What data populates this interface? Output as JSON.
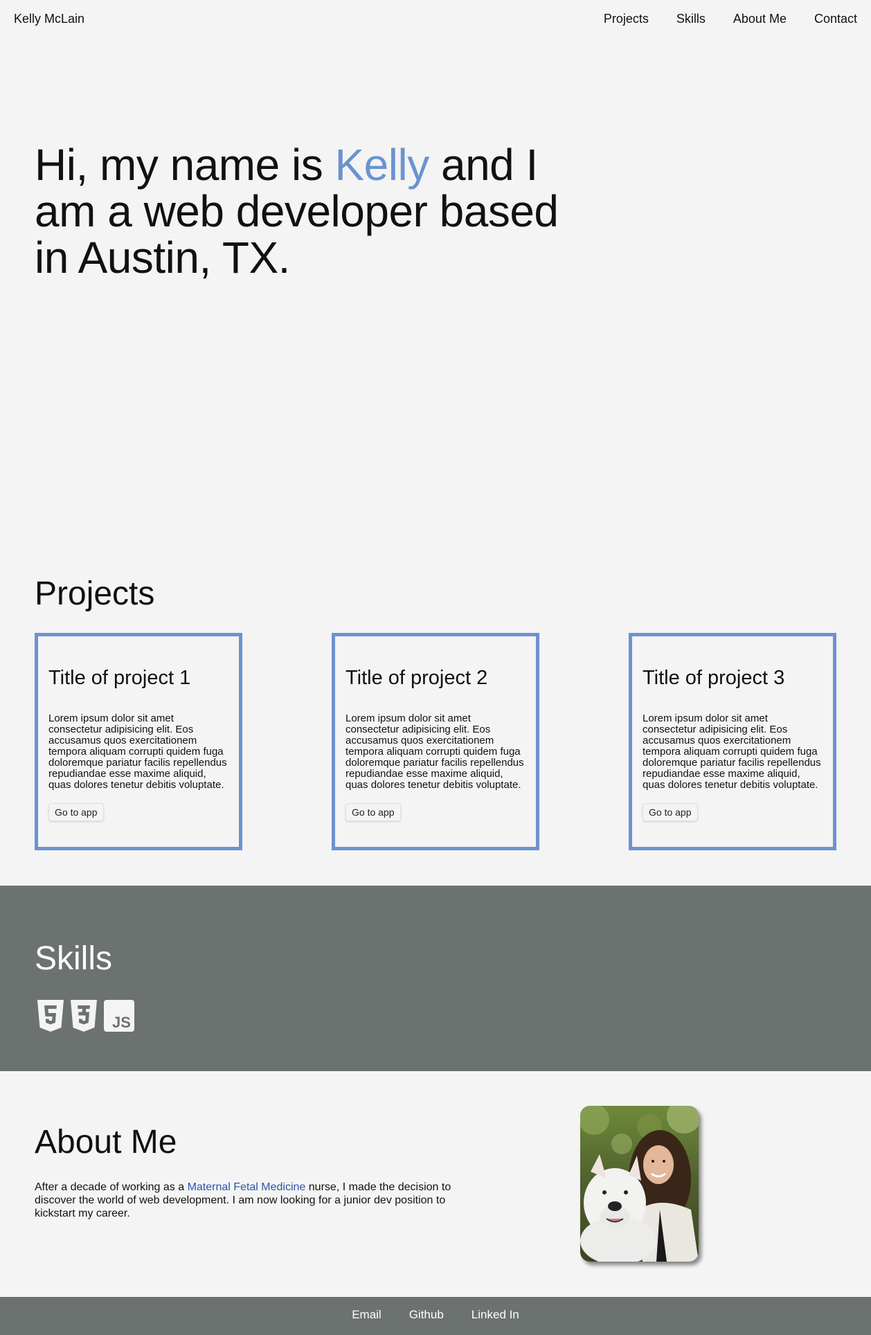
{
  "nav": {
    "brand": "Kelly McLain",
    "links": [
      "Projects",
      "Skills",
      "About Me",
      "Contact"
    ]
  },
  "hero": {
    "before": "Hi, my name is ",
    "name": "Kelly",
    "after": " and I am a web developer based in Austin, TX."
  },
  "projects": {
    "title": "Projects",
    "cards": [
      {
        "title": "Title of project 1",
        "body": "Lorem ipsum dolor sit amet consectetur adipisicing elit. Eos accusamus quos exercitationem tempora aliquam corrupti quidem fuga doloremque pariatur facilis repellendus repudiandae esse maxime aliquid, quas dolores tenetur debitis voluptate.",
        "button": "Go to app"
      },
      {
        "title": "Title of project 2",
        "body": "Lorem ipsum dolor sit amet consectetur adipisicing elit. Eos accusamus quos exercitationem tempora aliquam corrupti quidem fuga doloremque pariatur facilis repellendus repudiandae esse maxime aliquid, quas dolores tenetur debitis voluptate.",
        "button": "Go to app"
      },
      {
        "title": "Title of project 3",
        "body": "Lorem ipsum dolor sit amet consectetur adipisicing elit. Eos accusamus quos exercitationem tempora aliquam corrupti quidem fuga doloremque pariatur facilis repellendus repudiandae esse maxime aliquid, quas dolores tenetur debitis voluptate.",
        "button": "Go to app"
      }
    ]
  },
  "skills": {
    "title": "Skills",
    "icons": [
      "html5-icon",
      "css3-icon",
      "javascript-icon"
    ],
    "js_label": "JS"
  },
  "about": {
    "title": "About Me",
    "text_before": "After a decade of working as a ",
    "link": "Maternal Fetal Medicine",
    "text_after": " nurse, I made the decision to discover the world of web development. I am now looking for a junior dev position to kickstart my career."
  },
  "footer": {
    "links": [
      "Email",
      "Github",
      "Linked In"
    ]
  },
  "colors": {
    "accent": "#6b93d0",
    "band": "#6c7270",
    "background": "#f4f4f4",
    "link": "#2a55a8"
  }
}
